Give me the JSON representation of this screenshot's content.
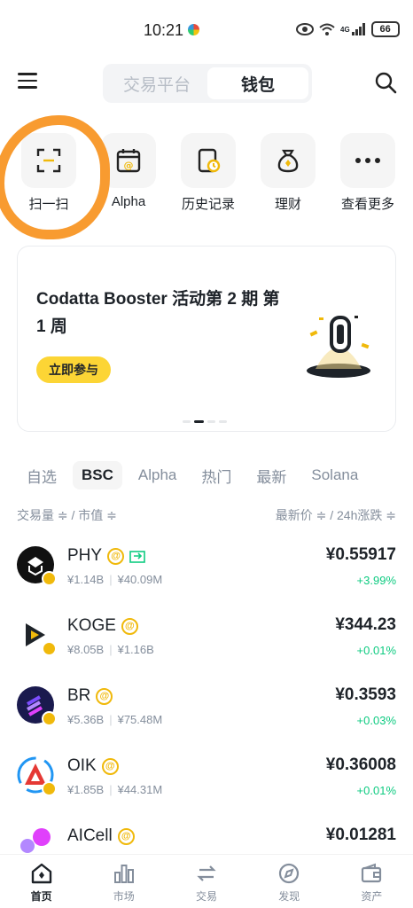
{
  "status_bar": {
    "time": "10:21",
    "network": "4G",
    "battery": "66"
  },
  "header": {
    "tabs": [
      {
        "label": "交易平台",
        "active": false
      },
      {
        "label": "钱包",
        "active": true
      }
    ]
  },
  "quick_actions": [
    {
      "label": "扫一扫",
      "icon": "scan-icon"
    },
    {
      "label": "Alpha",
      "icon": "alpha-calendar-icon"
    },
    {
      "label": "历史记录",
      "icon": "history-icon"
    },
    {
      "label": "理财",
      "icon": "money-bag-icon"
    },
    {
      "label": "查看更多",
      "icon": "more-icon"
    }
  ],
  "banner": {
    "title": "Codatta Booster 活动第 2 期 第 1 周",
    "button": "立即参与"
  },
  "market_tabs": [
    {
      "label": "自选",
      "active": false
    },
    {
      "label": "BSC",
      "active": true
    },
    {
      "label": "Alpha",
      "active": false
    },
    {
      "label": "热门",
      "active": false
    },
    {
      "label": "最新",
      "active": false
    },
    {
      "label": "Solana",
      "active": false
    }
  ],
  "sort": {
    "left": "交易量 ≑ / 市值 ≑",
    "right": "最新价 ≑ / 24h涨跌 ≑"
  },
  "tokens": [
    {
      "name": "PHY",
      "volume": "¥1.14B",
      "mcap": "¥40.09M",
      "price": "¥0.55917",
      "change": "+3.99%",
      "logo_color": "#111111"
    },
    {
      "name": "KOGE",
      "volume": "¥8.05B",
      "mcap": "¥1.16B",
      "price": "¥344.23",
      "change": "+0.01%",
      "logo_color": "#ffffff"
    },
    {
      "name": "BR",
      "volume": "¥5.36B",
      "mcap": "¥75.48M",
      "price": "¥0.3593",
      "change": "+0.03%",
      "logo_color": "#1a1a4e"
    },
    {
      "name": "OIK",
      "volume": "¥1.85B",
      "mcap": "¥44.31M",
      "price": "¥0.36008",
      "change": "+0.01%",
      "logo_color": "#ffffff"
    },
    {
      "name": "AICell",
      "volume": "",
      "mcap": "",
      "price": "¥0.01281",
      "change": "",
      "logo_color": "#e040fb"
    }
  ],
  "bottom_nav": [
    {
      "label": "首页",
      "icon": "home-icon",
      "active": true
    },
    {
      "label": "市场",
      "icon": "market-chart-icon",
      "active": false
    },
    {
      "label": "交易",
      "icon": "trade-swap-icon",
      "active": false
    },
    {
      "label": "发现",
      "icon": "compass-icon",
      "active": false
    },
    {
      "label": "资产",
      "icon": "wallet-icon",
      "active": false
    }
  ],
  "colors": {
    "brand_yellow": "#fcd535",
    "up_green": "#0ecb81",
    "annotation_orange": "#f7931e"
  }
}
